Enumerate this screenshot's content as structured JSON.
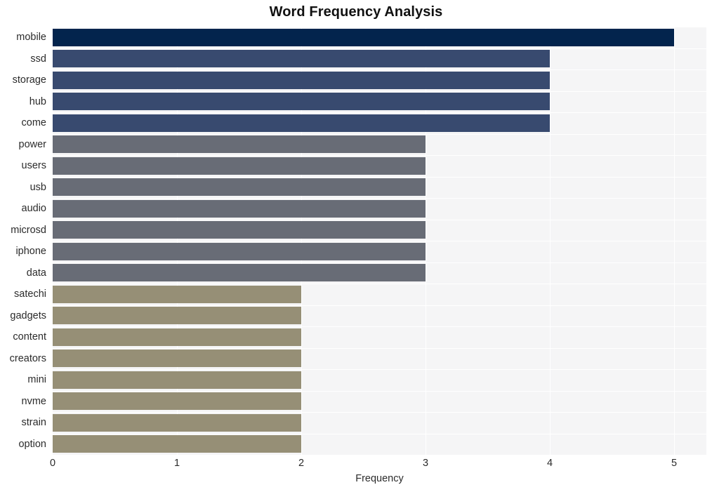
{
  "chart_data": {
    "type": "bar",
    "orientation": "horizontal",
    "title": "Word Frequency Analysis",
    "xlabel": "Frequency",
    "ylabel": "",
    "xlim": [
      0,
      5
    ],
    "xticks": [
      "0",
      "1",
      "2",
      "3",
      "4",
      "5"
    ],
    "grid": true,
    "legend": false,
    "categories": [
      "mobile",
      "ssd",
      "storage",
      "hub",
      "come",
      "power",
      "users",
      "usb",
      "audio",
      "microsd",
      "iphone",
      "data",
      "satechi",
      "gadgets",
      "content",
      "creators",
      "mini",
      "nvme",
      "strain",
      "option"
    ],
    "values": [
      5,
      4,
      4,
      4,
      4,
      3,
      3,
      3,
      3,
      3,
      3,
      3,
      2,
      2,
      2,
      2,
      2,
      2,
      2,
      2
    ],
    "bar_colors": [
      "#03244d",
      "#384a6f",
      "#384a6f",
      "#384a6f",
      "#384a6f",
      "#686c76",
      "#686c76",
      "#686c76",
      "#686c76",
      "#686c76",
      "#686c76",
      "#686c76",
      "#968f76",
      "#968f76",
      "#968f76",
      "#968f76",
      "#968f76",
      "#968f76",
      "#968f76",
      "#968f76"
    ]
  },
  "style": {
    "plot_background": "#f5f5f6",
    "grid_color": "#ffffff",
    "figure_background": "#ffffff",
    "text_color": "#2b2b2b"
  }
}
